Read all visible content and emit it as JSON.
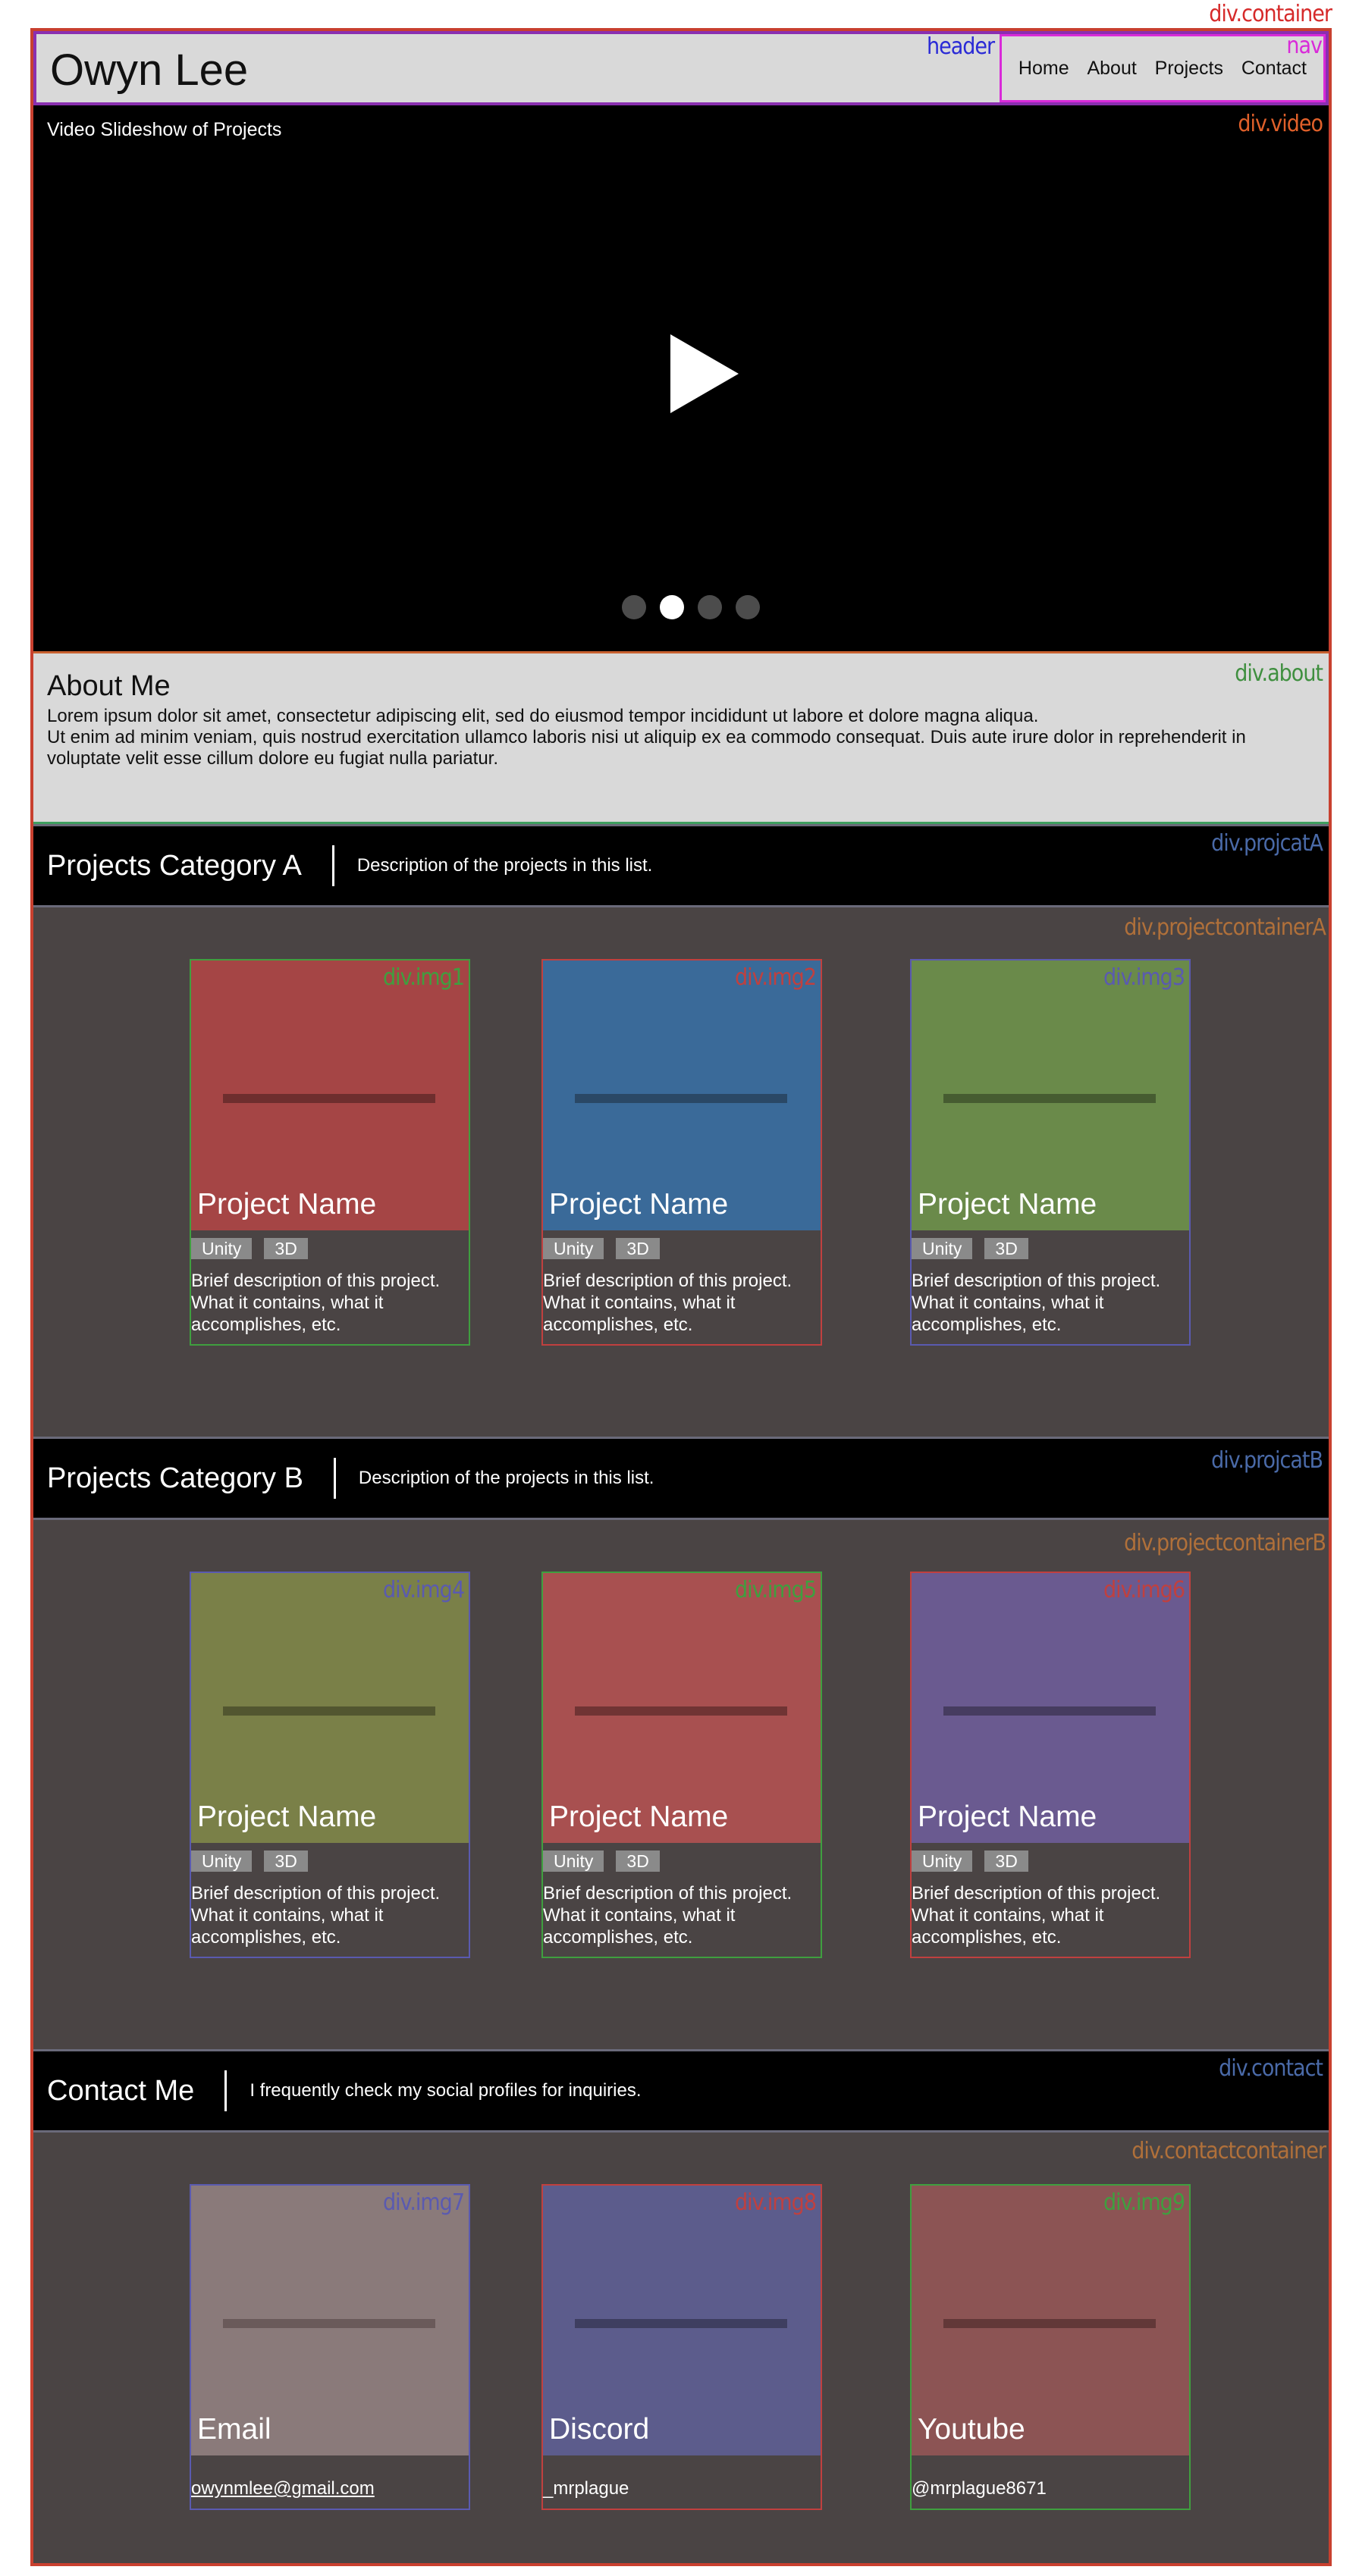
{
  "header": {
    "title": "Owyn Lee",
    "nav": [
      "Home",
      "About",
      "Projects",
      "Contact"
    ]
  },
  "debug_labels": {
    "container": "div.container",
    "header": "header",
    "nav": "nav",
    "video": "div.video",
    "about": "div.about",
    "projcatA": "div.projcatA",
    "projectcontainerA": "div.projectcontainerA",
    "projcatB": "div.projcatB",
    "projectcontainerB": "div.projectcontainerB",
    "contact": "div.contact",
    "contactcontainer": "div.contactcontainer"
  },
  "video": {
    "title": "Video Slideshow of Projects",
    "slide_count": 4,
    "active_slide": 2
  },
  "about": {
    "heading": "About Me",
    "line1": "Lorem ipsum dolor sit amet, consectetur adipiscing elit, sed do eiusmod tempor incididunt ut labore et dolore magna aliqua.",
    "line2": "Ut enim ad minim veniam, quis nostrud exercitation ullamco laboris nisi ut aliquip ex ea commodo consequat. Duis aute irure dolor in reprehenderit in voluptate velit esse cillum dolore eu fugiat nulla pariatur."
  },
  "categoryA": {
    "title": "Projects Category A",
    "description": "Description of the projects in this list.",
    "cards": [
      {
        "label": "div.img1",
        "name": "Project Name",
        "tags": [
          "Unity",
          "3D"
        ],
        "desc": "Brief description of this project. What it contains, what it accomplishes, etc.",
        "color": "#a54545",
        "line": "#6e2e2e",
        "border": "#3f9f3f",
        "labelColor": "#3f9f3f"
      },
      {
        "label": "div.img2",
        "name": "Project Name",
        "tags": [
          "Unity",
          "3D"
        ],
        "desc": "Brief description of this project. What it contains, what it accomplishes, etc.",
        "color": "#3a6a99",
        "line": "#2a4866",
        "border": "#c0403f",
        "labelColor": "#c0403f"
      },
      {
        "label": "div.img3",
        "name": "Project Name",
        "tags": [
          "Unity",
          "3D"
        ],
        "desc": "Brief description of this project. What it contains, what it accomplishes, etc.",
        "color": "#6a8a4a",
        "line": "#465c31",
        "border": "#5a5ab0",
        "labelColor": "#5a5ab0"
      }
    ]
  },
  "categoryB": {
    "title": "Projects Category B",
    "description": "Description of the projects in this list.",
    "cards": [
      {
        "label": "div.img4",
        "name": "Project Name",
        "tags": [
          "Unity",
          "3D"
        ],
        "desc": "Brief description of this project. What it contains, what it accomplishes, etc.",
        "color": "#7a8048",
        "line": "#525630",
        "border": "#5a5ab0",
        "labelColor": "#5a5ab0"
      },
      {
        "label": "div.img5",
        "name": "Project Name",
        "tags": [
          "Unity",
          "3D"
        ],
        "desc": "Brief description of this project. What it contains, what it accomplishes, etc.",
        "color": "#a85050",
        "line": "#703434",
        "border": "#3f9f3f",
        "labelColor": "#3f9f3f"
      },
      {
        "label": "div.img6",
        "name": "Project Name",
        "tags": [
          "Unity",
          "3D"
        ],
        "desc": "Brief description of this project. What it contains, what it accomplishes, etc.",
        "color": "#6a5a90",
        "line": "#463c60",
        "border": "#c0403f",
        "labelColor": "#c0403f"
      }
    ]
  },
  "contact": {
    "title": "Contact Me",
    "description": "I frequently check my social profiles for inquiries.",
    "cards": [
      {
        "label": "div.img7",
        "name": "Email",
        "value": "owynmlee@gmail.com",
        "link": true,
        "color": "#8a7a7a",
        "line": "#6a5a5a",
        "border": "#5a5ab0",
        "labelColor": "#5a5ab0"
      },
      {
        "label": "div.img8",
        "name": "Discord",
        "value": "_mrplague",
        "link": false,
        "color": "#5c5c8c",
        "line": "#3e3e60",
        "border": "#c0403f",
        "labelColor": "#c0403f"
      },
      {
        "label": "div.img9",
        "name": "Youtube",
        "value": "@mrplague8671",
        "link": false,
        "color": "#8c5454",
        "line": "#623838",
        "border": "#3f9f3f",
        "labelColor": "#3f9f3f"
      }
    ]
  }
}
